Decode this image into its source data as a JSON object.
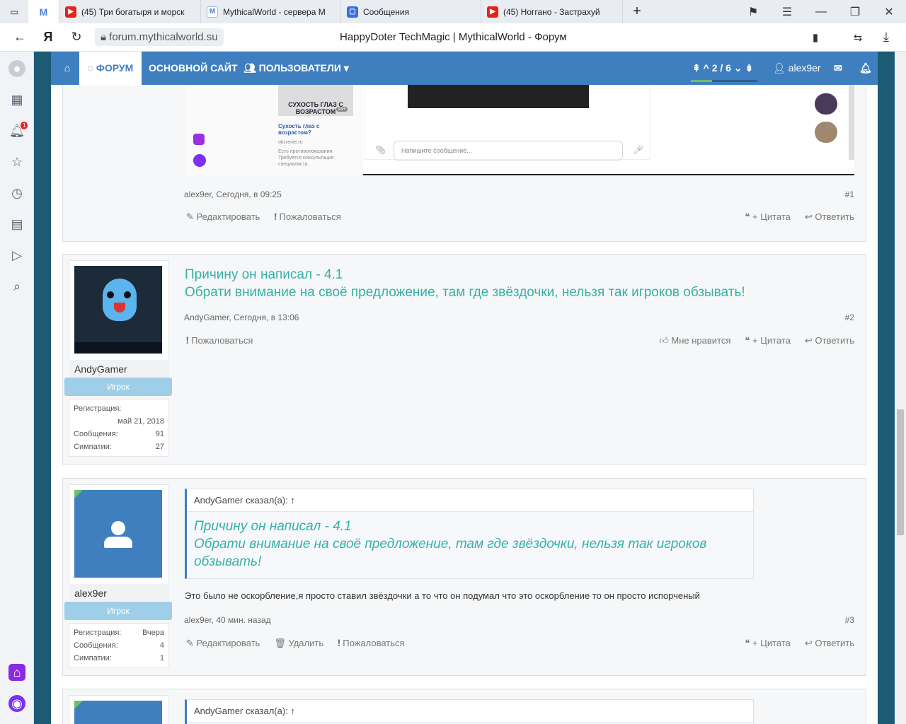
{
  "tabs": [
    {
      "title": "(45) Три богатыря и морск",
      "kind": "yt"
    },
    {
      "title": "MythicalWorld - сервера M",
      "kind": "mw"
    },
    {
      "title": "Сообщения",
      "kind": "msg"
    },
    {
      "title": "(45) Ноггано - Застрахуй",
      "kind": "yt"
    }
  ],
  "browser": {
    "url": "forum.mythicalworld.su",
    "page_title": "HappyDoter TechMagic | MythicalWorld - Форум",
    "new_tab": "+"
  },
  "sidebar": {
    "notif_count": "1"
  },
  "nav": {
    "forum": "ФОРУМ",
    "main_site": "ОСНОВНОЙ САЙТ",
    "users": "ПОЛЬЗОВАТЕЛИ",
    "pager": "2 / 6",
    "user": "alex9er"
  },
  "embed": {
    "ad_title": "СУХОСТЬ ГЛАЗ С ВОЗРАСТОМ",
    "ad_sub": "Сухость глаз с возрастом?",
    "ad_site": "okzrenie.ru",
    "ad_warn": "Есть противопоказания. Требуется консультация специалиста.",
    "msg_placeholder": "Напишите сообщение...",
    "age": "18+"
  },
  "posts": [
    {
      "meta": "alex9er, Сегодня, в 09:25",
      "num": "#1",
      "edit": "Редактировать",
      "report": "Пожаловаться",
      "quote": "+ Цитата",
      "reply": "Ответить"
    },
    {
      "author": "AndyGamer",
      "role": "Игрок",
      "reg_label": "Регистрация:",
      "reg": "май 21, 2018",
      "msgs_label": "Сообщения:",
      "msgs": "91",
      "likes_label": "Симпатии:",
      "likes": "27",
      "line1": "Причину он написал - 4.1",
      "line2": "Обрати внимание на своё предложение, там где звёздочки, нельзя так игроков обзывать!",
      "meta": "AndyGamer, Сегодня, в 13:06",
      "num": "#2",
      "report": "Пожаловаться",
      "like": "Мне нравится",
      "quote": "+ Цитата",
      "reply": "Ответить"
    },
    {
      "author": "alex9er",
      "role": "Игрок",
      "reg_label": "Регистрация:",
      "reg": "Вчера",
      "msgs_label": "Сообщения:",
      "msgs": "4",
      "likes_label": "Симпатии:",
      "likes": "1",
      "q_head": "AndyGamer сказал(а): ↑",
      "q1": "Причину он написал - 4.1",
      "q2": "Обрати внимание на своё предложение, там где звёздочки, нельзя так игроков обзывать!",
      "text": "Это было не оскорбление,я просто ставил звёздочки а то что он подумал что это оскорбление то он просто испорченый",
      "meta": "alex9er, 40 мин. назад",
      "num": "#3",
      "edit": "Редактировать",
      "delete": "Удалить",
      "report": "Пожаловаться",
      "quote": "+ Цитата",
      "reply": "Ответить"
    },
    {
      "q_head": "AndyGamer сказал(а): ↑"
    }
  ]
}
